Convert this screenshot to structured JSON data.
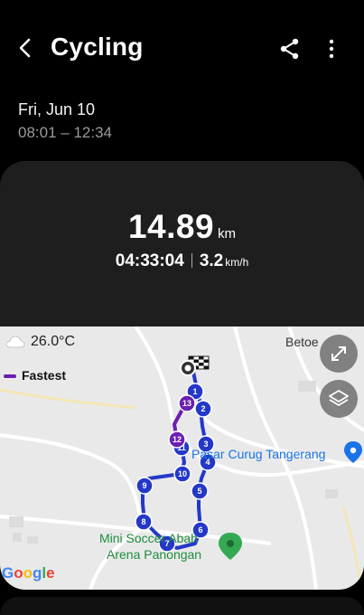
{
  "header": {
    "title": "Cycling",
    "back_icon": "back-arrow-icon",
    "share_icon": "share-icon",
    "more_icon": "more-vertical-icon"
  },
  "session": {
    "date": "Fri, Jun 10",
    "time_range": "08:01 – 12:34"
  },
  "summary": {
    "distance_value": "14.89",
    "distance_unit": "km",
    "duration": "04:33:04",
    "speed_value": "3.2",
    "speed_unit": "km/h"
  },
  "map": {
    "temperature": "26.0°C",
    "legend_label": "Fastest",
    "route_color": "#2438c8",
    "fastest_color": "#6a1fb2",
    "places": {
      "betoe": "Betoe",
      "pasar": "Pasar Curug Tangerang",
      "mini_soccer_1": "Mini Soccer Abah",
      "mini_soccer_2": "Arena Panongan"
    },
    "markers": [
      "1",
      "2",
      "3",
      "4",
      "5",
      "6",
      "7",
      "8",
      "9",
      "10",
      "11",
      "12",
      "13"
    ],
    "attribution": [
      "G",
      "o",
      "o",
      "g",
      "l",
      "e"
    ],
    "expand_icon": "expand-icon",
    "layers_icon": "layers-icon"
  }
}
